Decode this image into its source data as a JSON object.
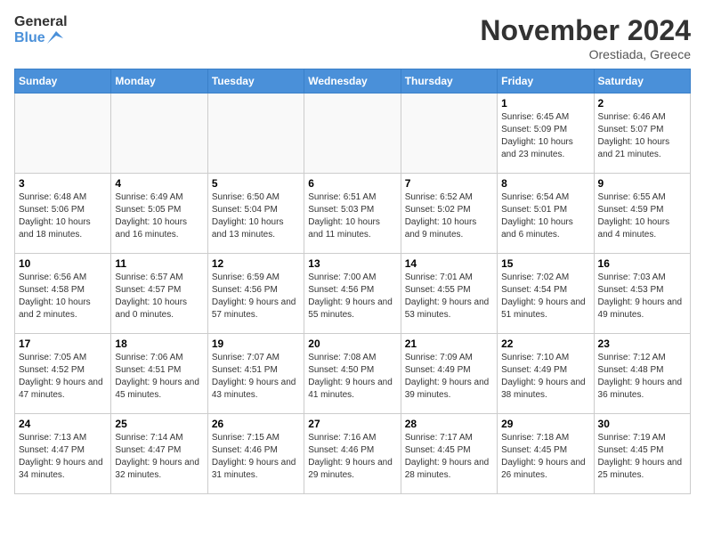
{
  "header": {
    "logo_line1": "General",
    "logo_line2": "Blue",
    "month": "November 2024",
    "location": "Orestiada, Greece"
  },
  "weekdays": [
    "Sunday",
    "Monday",
    "Tuesday",
    "Wednesday",
    "Thursday",
    "Friday",
    "Saturday"
  ],
  "weeks": [
    [
      {
        "day": "",
        "info": ""
      },
      {
        "day": "",
        "info": ""
      },
      {
        "day": "",
        "info": ""
      },
      {
        "day": "",
        "info": ""
      },
      {
        "day": "",
        "info": ""
      },
      {
        "day": "1",
        "info": "Sunrise: 6:45 AM\nSunset: 5:09 PM\nDaylight: 10 hours and 23 minutes."
      },
      {
        "day": "2",
        "info": "Sunrise: 6:46 AM\nSunset: 5:07 PM\nDaylight: 10 hours and 21 minutes."
      }
    ],
    [
      {
        "day": "3",
        "info": "Sunrise: 6:48 AM\nSunset: 5:06 PM\nDaylight: 10 hours and 18 minutes."
      },
      {
        "day": "4",
        "info": "Sunrise: 6:49 AM\nSunset: 5:05 PM\nDaylight: 10 hours and 16 minutes."
      },
      {
        "day": "5",
        "info": "Sunrise: 6:50 AM\nSunset: 5:04 PM\nDaylight: 10 hours and 13 minutes."
      },
      {
        "day": "6",
        "info": "Sunrise: 6:51 AM\nSunset: 5:03 PM\nDaylight: 10 hours and 11 minutes."
      },
      {
        "day": "7",
        "info": "Sunrise: 6:52 AM\nSunset: 5:02 PM\nDaylight: 10 hours and 9 minutes."
      },
      {
        "day": "8",
        "info": "Sunrise: 6:54 AM\nSunset: 5:01 PM\nDaylight: 10 hours and 6 minutes."
      },
      {
        "day": "9",
        "info": "Sunrise: 6:55 AM\nSunset: 4:59 PM\nDaylight: 10 hours and 4 minutes."
      }
    ],
    [
      {
        "day": "10",
        "info": "Sunrise: 6:56 AM\nSunset: 4:58 PM\nDaylight: 10 hours and 2 minutes."
      },
      {
        "day": "11",
        "info": "Sunrise: 6:57 AM\nSunset: 4:57 PM\nDaylight: 10 hours and 0 minutes."
      },
      {
        "day": "12",
        "info": "Sunrise: 6:59 AM\nSunset: 4:56 PM\nDaylight: 9 hours and 57 minutes."
      },
      {
        "day": "13",
        "info": "Sunrise: 7:00 AM\nSunset: 4:56 PM\nDaylight: 9 hours and 55 minutes."
      },
      {
        "day": "14",
        "info": "Sunrise: 7:01 AM\nSunset: 4:55 PM\nDaylight: 9 hours and 53 minutes."
      },
      {
        "day": "15",
        "info": "Sunrise: 7:02 AM\nSunset: 4:54 PM\nDaylight: 9 hours and 51 minutes."
      },
      {
        "day": "16",
        "info": "Sunrise: 7:03 AM\nSunset: 4:53 PM\nDaylight: 9 hours and 49 minutes."
      }
    ],
    [
      {
        "day": "17",
        "info": "Sunrise: 7:05 AM\nSunset: 4:52 PM\nDaylight: 9 hours and 47 minutes."
      },
      {
        "day": "18",
        "info": "Sunrise: 7:06 AM\nSunset: 4:51 PM\nDaylight: 9 hours and 45 minutes."
      },
      {
        "day": "19",
        "info": "Sunrise: 7:07 AM\nSunset: 4:51 PM\nDaylight: 9 hours and 43 minutes."
      },
      {
        "day": "20",
        "info": "Sunrise: 7:08 AM\nSunset: 4:50 PM\nDaylight: 9 hours and 41 minutes."
      },
      {
        "day": "21",
        "info": "Sunrise: 7:09 AM\nSunset: 4:49 PM\nDaylight: 9 hours and 39 minutes."
      },
      {
        "day": "22",
        "info": "Sunrise: 7:10 AM\nSunset: 4:49 PM\nDaylight: 9 hours and 38 minutes."
      },
      {
        "day": "23",
        "info": "Sunrise: 7:12 AM\nSunset: 4:48 PM\nDaylight: 9 hours and 36 minutes."
      }
    ],
    [
      {
        "day": "24",
        "info": "Sunrise: 7:13 AM\nSunset: 4:47 PM\nDaylight: 9 hours and 34 minutes."
      },
      {
        "day": "25",
        "info": "Sunrise: 7:14 AM\nSunset: 4:47 PM\nDaylight: 9 hours and 32 minutes."
      },
      {
        "day": "26",
        "info": "Sunrise: 7:15 AM\nSunset: 4:46 PM\nDaylight: 9 hours and 31 minutes."
      },
      {
        "day": "27",
        "info": "Sunrise: 7:16 AM\nSunset: 4:46 PM\nDaylight: 9 hours and 29 minutes."
      },
      {
        "day": "28",
        "info": "Sunrise: 7:17 AM\nSunset: 4:45 PM\nDaylight: 9 hours and 28 minutes."
      },
      {
        "day": "29",
        "info": "Sunrise: 7:18 AM\nSunset: 4:45 PM\nDaylight: 9 hours and 26 minutes."
      },
      {
        "day": "30",
        "info": "Sunrise: 7:19 AM\nSunset: 4:45 PM\nDaylight: 9 hours and 25 minutes."
      }
    ]
  ]
}
